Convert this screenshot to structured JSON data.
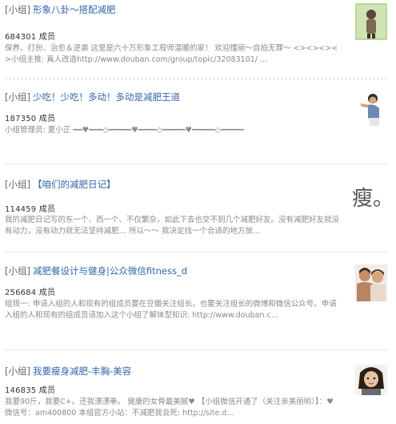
{
  "groups": [
    {
      "tag": "[小组]",
      "title": "形象八卦～搭配减肥",
      "members": "684301 成员",
      "desc": "保养、打扮、治愈＆逆袭 这里是六十万形象工程师温暖的家！ 欢迎懂丽～自拍无罪～ <><><><>小组主推: 真人改造http://www.douban.com/group/topic/32083101/ ...",
      "thumb_icon": "green-figure-avatar"
    },
    {
      "tag": "[小组]",
      "title": "少吃！少吃！多动！多动是减肥王道",
      "members": "187350 成员",
      "desc": "小组管理员: 夏小正 ━━♥━━━◇━━━━━♥━━━━◇━━━━━♥━━━━━◇━━━━━",
      "thumb_icon": "fitness-woman-avatar"
    },
    {
      "tag": "[小组]",
      "title": "【咱们的减肥日记】",
      "members": "114459 成员",
      "desc": "我的减肥日记写的东一个、西一个、不仅繁杂，如此下去也交不到几个减肥好友。没有减肥好友就没有动力，没有动力就无法坚持减肥… 所以～～ 我决定找一个合适的地方放…",
      "thumb_text": "瘦。"
    },
    {
      "tag": "[小组]",
      "title": "减肥餐设计与健身|公众微信fitness_d",
      "members": "256684 成员",
      "desc": "组规一: 申请入组的人和现有的组成员要在豆瓣关注组长，也要关注组长的微博和微信公众号。申请入组的人和现有的组成员请加入这个小组了解体型知识: http://www.douban.c...",
      "thumb_icon": "couple-avatar"
    },
    {
      "tag": "[小组]",
      "title": "我要瘦身减肥-丰胸-美容",
      "members": "146835 成员",
      "desc": "我要90斤，我要C+。还我漂漂拳。 健康的女骨最美腻♥ 【小组微信开通了（关注亲美丽哟）】：♥ 微信号：am400800 本组官方小站：不减肥我会死: http://site.d...",
      "thumb_icon": "girl-avatar"
    }
  ]
}
